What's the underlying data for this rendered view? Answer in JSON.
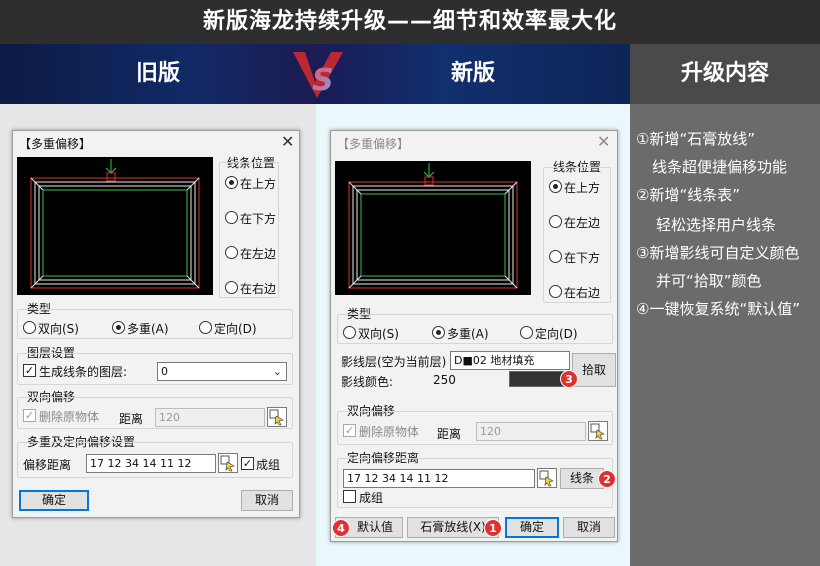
{
  "page_title": "新版海龙持续升级——细节和效率最大化",
  "headers": {
    "old": "旧版",
    "new": "新版",
    "upgrade": "升级内容",
    "vs": "VS"
  },
  "upgrade_lines": [
    "①新增“石膏放线”",
    "线条超便捷偏移功能",
    "②新增“线条表”",
    "轻松选择用户线条",
    "③新增影线可自定义颜色",
    "并可“拾取”颜色",
    "④一键恢复系统“默认值”"
  ],
  "old_dialog": {
    "title": "【多重偏移】",
    "close": "✕",
    "line_position_label": "线条位置",
    "positions": [
      "在上方",
      "在下方",
      "在左边",
      "在右边"
    ],
    "type_label": "类型",
    "types": [
      "双向(S)",
      "多重(A)",
      "定向(D)"
    ],
    "layer_label": "图层设置",
    "generate_layer_label": "生成线条的图层:",
    "layer_value": "0",
    "bidirectional_label": "双向偏移",
    "delete_original_label": "删除原物体",
    "distance_label": "距离",
    "distance_value": "120",
    "multi_label": "多重及定向偏移设置",
    "offset_distance_label": "偏移距离",
    "offset_value": "17 12 34 14 11 12",
    "group_label": "成组",
    "ok": "确定",
    "cancel": "取消"
  },
  "new_dialog": {
    "title": "【多重偏移】",
    "close": "✕",
    "line_position_label": "线条位置",
    "positions": [
      "在上方",
      "在左边",
      "在下方",
      "在右边"
    ],
    "type_label": "类型",
    "types": [
      "双向(S)",
      "多重(A)",
      "定向(D)"
    ],
    "hatch_layer_label": "影线层(空为当前层)",
    "hatch_layer_value": "D■02 地材填充",
    "hatch_color_label": "影线颜色:",
    "hatch_color_value": "250",
    "hatch_color_swatch": "#333333",
    "pick": "拾取",
    "bidirectional_label": "双向偏移",
    "delete_original_label": "删除原物体",
    "distance_label": "距离",
    "distance_value": "120",
    "directional_label": "定向偏移距离",
    "offset_value": "17 12 34 14 11 12",
    "lines_btn": "线条",
    "group_label": "成组",
    "default_btn": "默认值",
    "gypsum_btn": "石膏放线(X)",
    "ok": "确定",
    "cancel": "取消",
    "badges": [
      "1",
      "2",
      "3",
      "4"
    ]
  },
  "colors": {
    "accent": "#0078d7",
    "badge": "#e03030",
    "frame_red": "#e03030",
    "frame_green": "#3cbf4a",
    "frame_white": "#e8e8e8"
  }
}
